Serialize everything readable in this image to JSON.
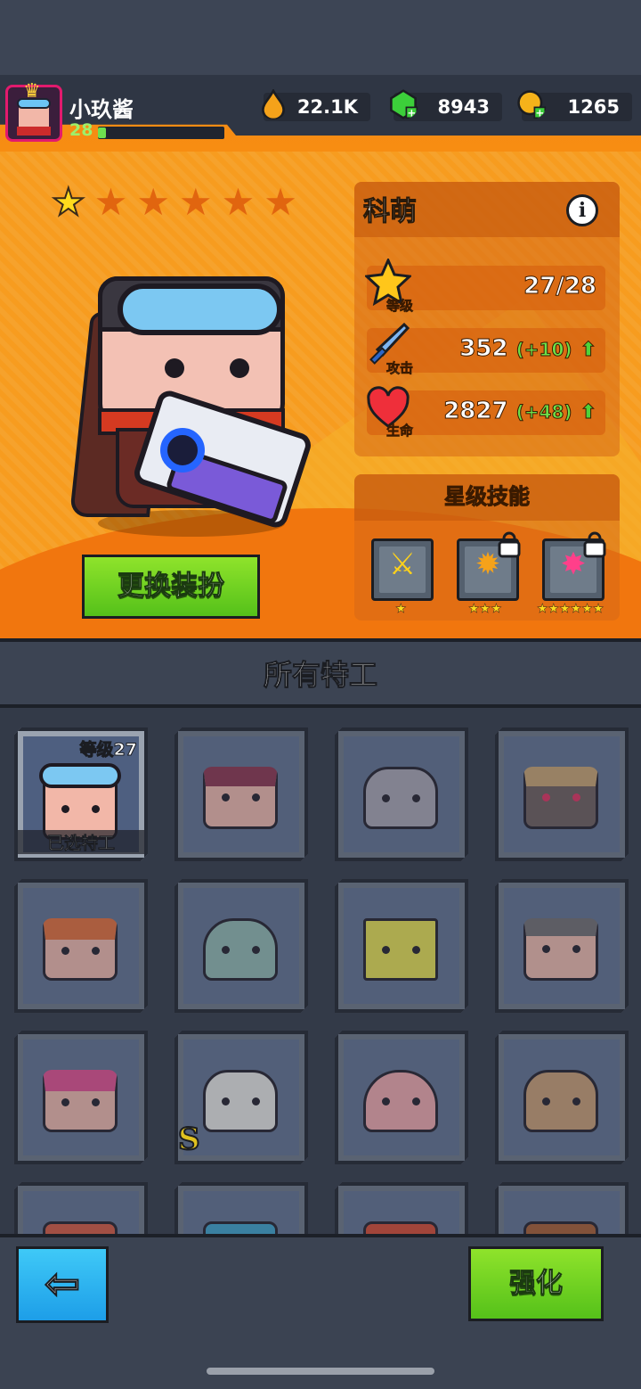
{
  "player": {
    "name": "小玖酱",
    "level": "28",
    "xp_fraction": 0.06
  },
  "resources": [
    {
      "icon": "fuel-drop-icon",
      "value": "22.1K",
      "color": "#f5a21a"
    },
    {
      "icon": "green-gem-icon",
      "value": "8943",
      "color": "#3ccf3a"
    },
    {
      "icon": "gold-coin-icon",
      "value": "1265",
      "color": "#f5b21a"
    }
  ],
  "hero": {
    "name": "科萌",
    "stars_filled": 1,
    "stars_total": 6,
    "stats": {
      "level_label": "等级",
      "level_value": "27/28",
      "attack_label": "攻击",
      "attack_value": "352",
      "attack_increase": "(+10)",
      "hp_label": "生命",
      "hp_value": "2827",
      "hp_increase": "(+48)"
    }
  },
  "buttons": {
    "change_costume": "更换装扮",
    "upgrade": "强化",
    "back_symbol": "⇦"
  },
  "skills": {
    "title": "星级技能",
    "items": [
      {
        "icon": "sword-plus-icon",
        "stars": "★",
        "locked": false
      },
      {
        "icon": "swirl-plus-icon",
        "stars": "★★★",
        "locked": true
      },
      {
        "icon": "pink-bomb-icon",
        "stars": "★★★★★★",
        "locked": true
      }
    ]
  },
  "agents": {
    "title": "所有特工",
    "selected_level": "等级27",
    "selected_tag": "已选特工",
    "s_badge": "S"
  }
}
